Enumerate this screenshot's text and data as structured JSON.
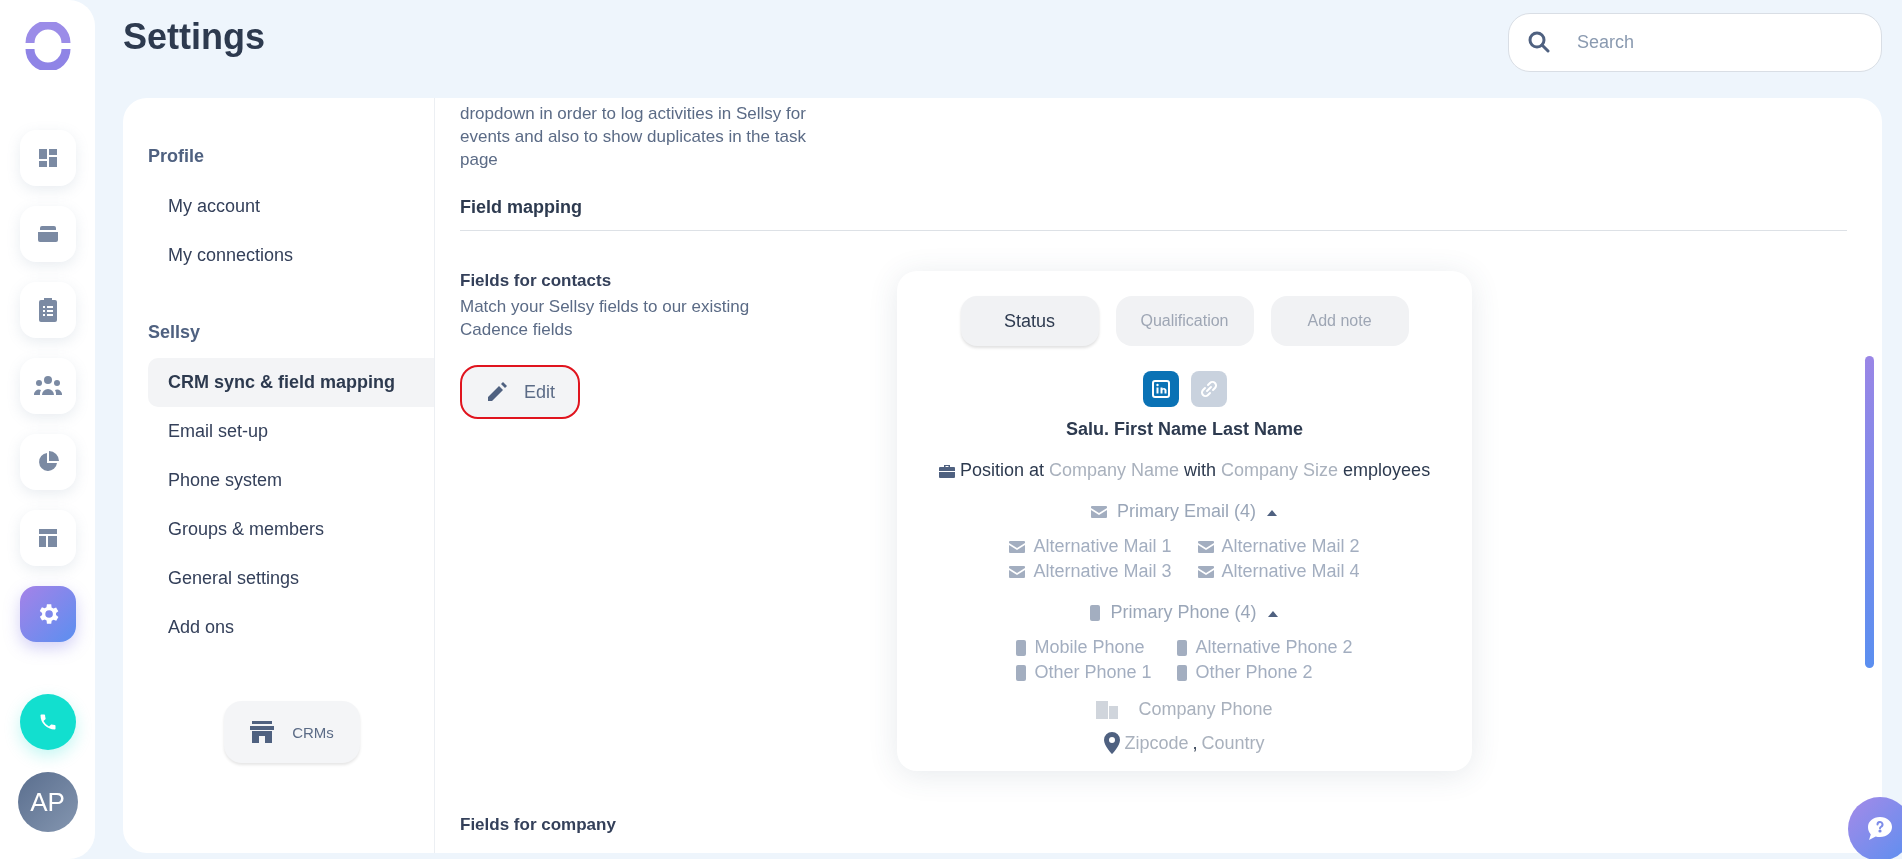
{
  "rail": {
    "items": [
      {
        "selected": false
      },
      {
        "selected": false
      },
      {
        "selected": false
      },
      {
        "selected": false
      },
      {
        "selected": false
      },
      {
        "selected": false
      },
      {
        "selected": true
      }
    ],
    "avatar": "AP"
  },
  "header": {
    "title": "Settings",
    "search": {
      "placeholder": "Search"
    }
  },
  "nav": {
    "sections": [
      {
        "title": "Profile",
        "items": [
          {
            "label": "My account",
            "selected": false
          },
          {
            "label": "My connections",
            "selected": false
          }
        ]
      },
      {
        "title": "Sellsy",
        "items": [
          {
            "label": "CRM sync & field mapping",
            "selected": true
          },
          {
            "label": "Email set-up",
            "selected": false
          },
          {
            "label": "Phone system",
            "selected": false
          },
          {
            "label": "Groups & members",
            "selected": false
          },
          {
            "label": "General settings",
            "selected": false
          },
          {
            "label": "Add ons",
            "selected": false
          }
        ]
      }
    ],
    "crms_button": "CRMs"
  },
  "content": {
    "intro": "dropdown in order to log activities in Sellsy for events and also to show duplicates in the task page",
    "section_title": "Field mapping",
    "contacts": {
      "title": "Fields for contacts",
      "description": "Match your Sellsy fields to our existing Cadence fields",
      "edit_button": "Edit"
    },
    "card": {
      "tabs": [
        {
          "label": "Status",
          "selected": true
        },
        {
          "label": "Qualification",
          "selected": false
        },
        {
          "label": "Add note",
          "selected": false
        }
      ],
      "name": "Salu. First Name Last Name",
      "position": [
        {
          "text": "Position at",
          "muted": false
        },
        {
          "text": "Company Name",
          "muted": true
        },
        {
          "text": "with",
          "muted": false
        },
        {
          "text": "Company Size",
          "muted": true
        },
        {
          "text": "employees",
          "muted": false
        }
      ],
      "email_group": {
        "label": "Primary Email (4)",
        "expanded": true,
        "items": [
          "Alternative Mail 1",
          "Alternative Mail 2",
          "Alternative Mail 3",
          "Alternative Mail 4"
        ]
      },
      "phone_group": {
        "label": "Primary Phone (4)",
        "expanded": true,
        "items": [
          "Mobile Phone",
          "Alternative Phone 2",
          "Other Phone 1",
          "Other Phone 2"
        ]
      },
      "company_phone": "Company Phone",
      "location": [
        {
          "text": "Zipcode",
          "muted": true
        },
        {
          "text": ",",
          "muted": false
        },
        {
          "text": "Country",
          "muted": true
        }
      ]
    },
    "company_title": "Fields for company"
  }
}
